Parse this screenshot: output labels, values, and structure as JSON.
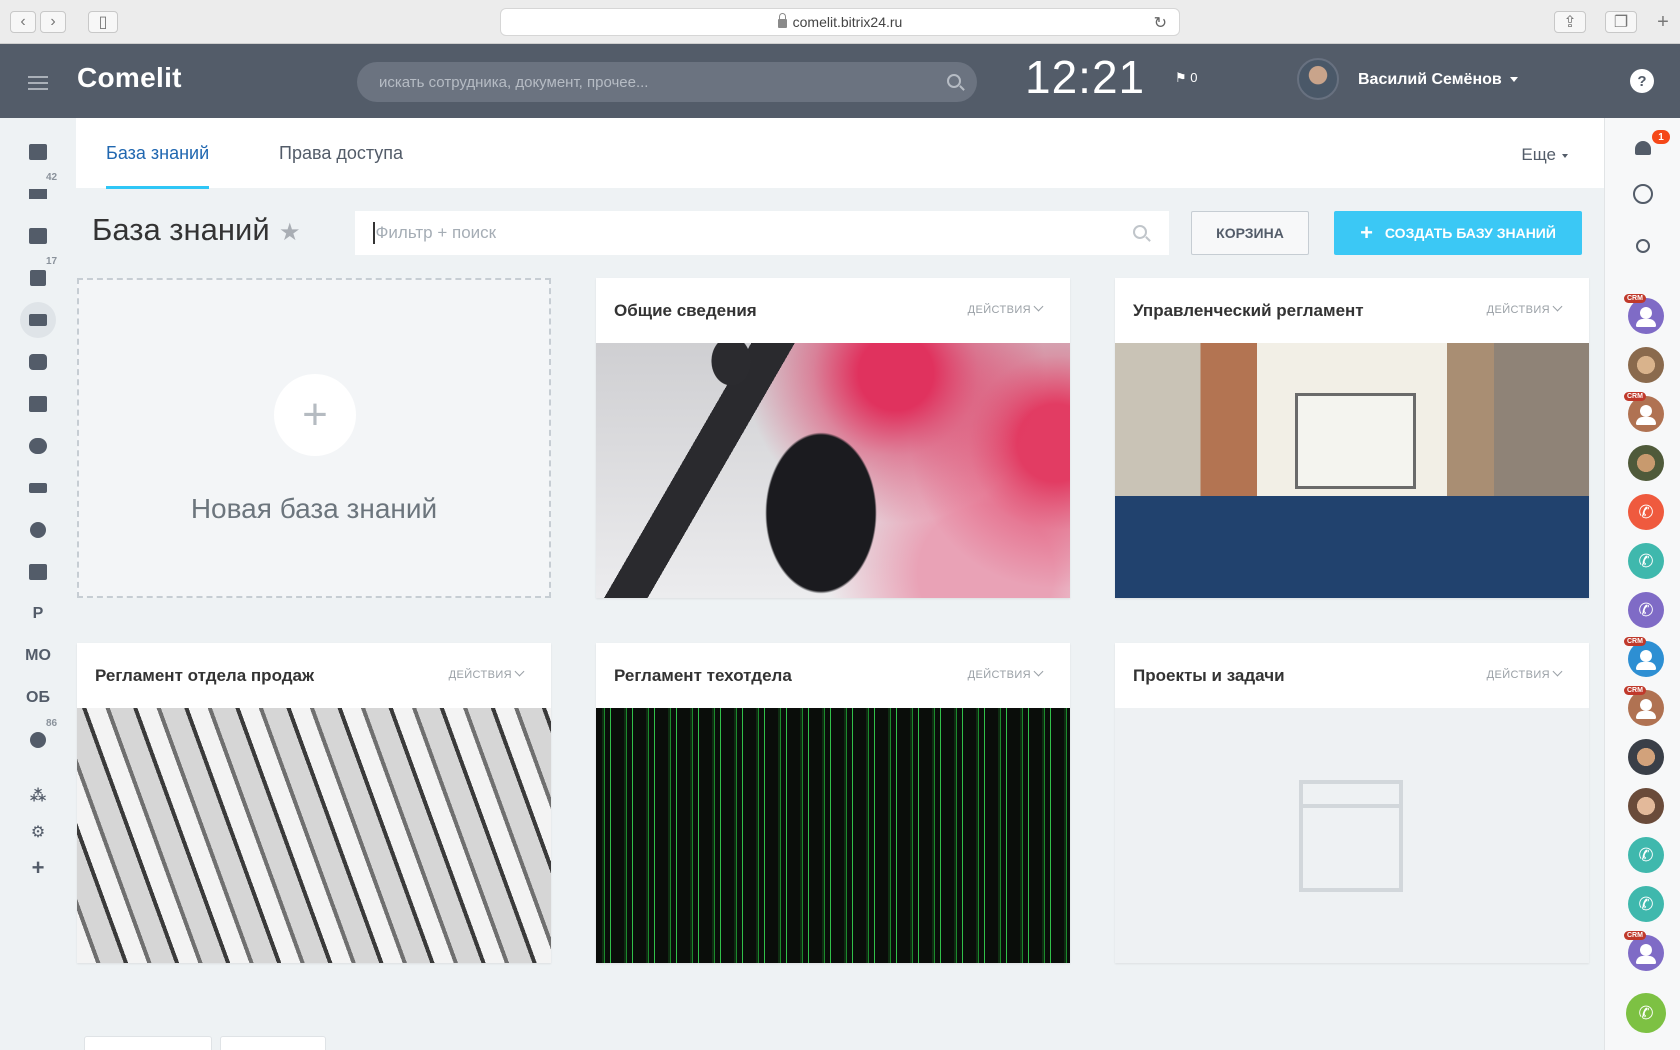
{
  "browser": {
    "url": "comelit.bitrix24.ru"
  },
  "header": {
    "logo": "Comelit",
    "search_placeholder": "искать сотрудника, документ, прочее...",
    "clock": "12:21",
    "flag_count": "0",
    "user_name": "Василий Семёнов",
    "help": "?"
  },
  "left_nav": {
    "badges": {
      "feed": "42",
      "tasks": "17",
      "more": "86"
    },
    "text_items": [
      "Р",
      "МО",
      "ОБ"
    ]
  },
  "right_bar": {
    "notifications_count": "1",
    "crm_tag": "CRM"
  },
  "tabs": [
    {
      "label": "База знаний",
      "active": true
    },
    {
      "label": "Права доступа",
      "active": false
    }
  ],
  "more_tab": "Еще",
  "page": {
    "title": "База знаний",
    "filter_placeholder": "Фильтр + поиск",
    "trash_button": "КОРЗИНА",
    "create_button": "СОЗДАТЬ БАЗУ ЗНАНИЙ",
    "new_card_label": "Новая база знаний"
  },
  "cards": [
    {
      "title": "Общие сведения",
      "actions": "ДЕЙСТВИЯ",
      "image": "smoke-protester"
    },
    {
      "title": "Управленческий регламент",
      "actions": "ДЕЙСТВИЯ",
      "image": "office-meeting"
    },
    {
      "title": "Регламент отдела продаж",
      "actions": "ДЕЙСТВИЯ",
      "image": "dollar-bills"
    },
    {
      "title": "Регламент техотдела",
      "actions": "ДЕЙСТВИЯ",
      "image": "matrix-code"
    },
    {
      "title": "Проекты и задачи",
      "actions": "ДЕЙСТВИЯ",
      "image": "placeholder"
    }
  ],
  "colors": {
    "header_bg": "#535c69",
    "accent_blue": "#3bc8f5",
    "tab_active": "#2067b0",
    "badge_red": "#f54819"
  }
}
